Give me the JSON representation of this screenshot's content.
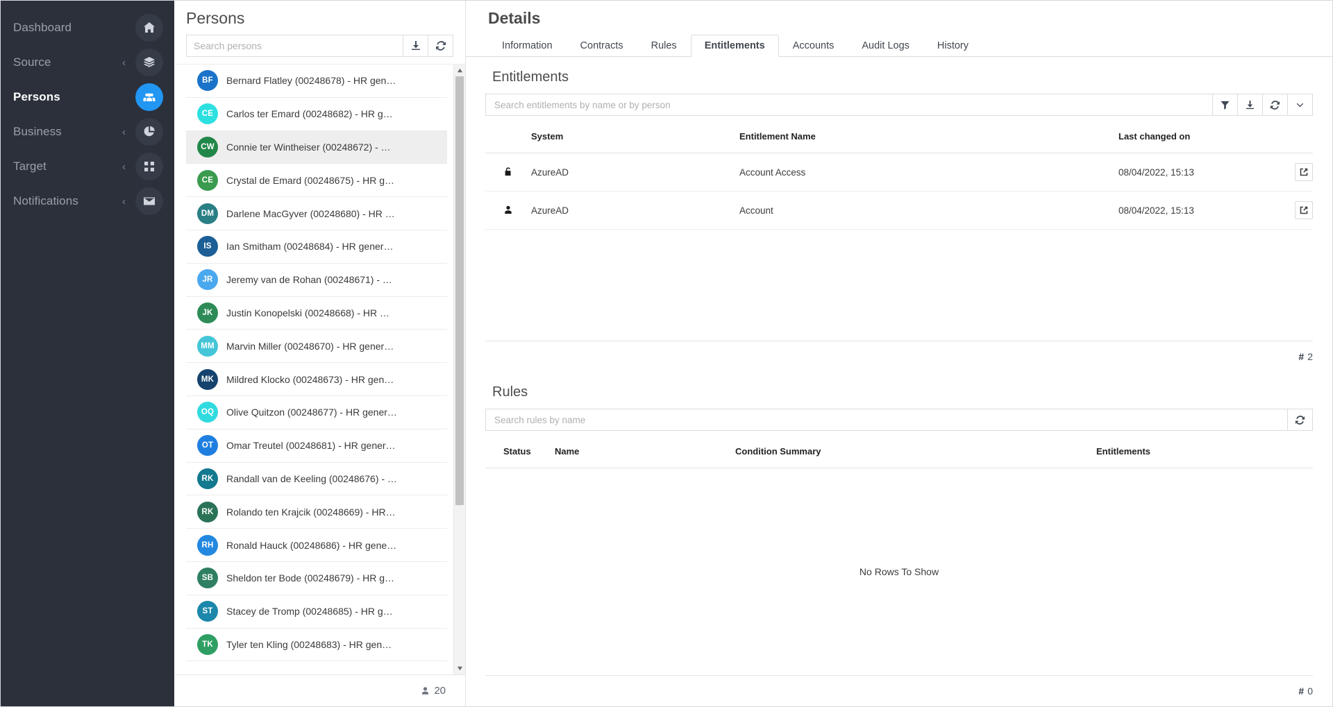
{
  "sidebar": {
    "items": [
      {
        "label": "Dashboard",
        "icon": "home-icon",
        "caret": false,
        "active": false
      },
      {
        "label": "Source",
        "icon": "layers-icon",
        "caret": true,
        "active": false
      },
      {
        "label": "Persons",
        "icon": "people-icon",
        "caret": false,
        "active": true
      },
      {
        "label": "Business",
        "icon": "pie-chart-icon",
        "caret": true,
        "active": false
      },
      {
        "label": "Target",
        "icon": "grid-icon",
        "caret": true,
        "active": false
      },
      {
        "label": "Notifications",
        "icon": "envelope-icon",
        "caret": true,
        "active": false
      }
    ],
    "caret_glyph": "‹",
    "accent_color": "#2196f3",
    "background_color": "#2b303b"
  },
  "persons": {
    "title": "Persons",
    "search_placeholder": "Search persons",
    "download_label": "download-icon",
    "refresh_label": "refresh-icon",
    "count": "20",
    "items": [
      {
        "initials": "BF",
        "color": "#1a73c8",
        "label": "Bernard Flatley (00248678) - HR gen…",
        "selected": false
      },
      {
        "initials": "CE",
        "color": "#2de0e0",
        "label": "Carlos ter Emard (00248682) - HR g…",
        "selected": false
      },
      {
        "initials": "CW",
        "color": "#218749",
        "label": "Connie ter Wintheiser (00248672) - …",
        "selected": true
      },
      {
        "initials": "CE",
        "color": "#3a9b4e",
        "label": "Crystal de Emard (00248675) - HR g…",
        "selected": false
      },
      {
        "initials": "DM",
        "color": "#2a7f85",
        "label": "Darlene MacGyver (00248680) - HR …",
        "selected": false
      },
      {
        "initials": "IS",
        "color": "#1b5f96",
        "label": "Ian Smitham (00248684) - HR gener…",
        "selected": false
      },
      {
        "initials": "JR",
        "color": "#4aa8ef",
        "label": "Jeremy van de Rohan (00248671) - …",
        "selected": false
      },
      {
        "initials": "JK",
        "color": "#2e8b57",
        "label": "Justin Konopelski (00248668) - HR …",
        "selected": false
      },
      {
        "initials": "MM",
        "color": "#44c6d8",
        "label": "Marvin Miller (00248670) - HR gener…",
        "selected": false
      },
      {
        "initials": "MK",
        "color": "#16436e",
        "label": "Mildred Klocko (00248673) - HR gen…",
        "selected": false
      },
      {
        "initials": "OQ",
        "color": "#30dbe0",
        "label": "Olive Quitzon (00248677) - HR gener…",
        "selected": false
      },
      {
        "initials": "OT",
        "color": "#1f7fe0",
        "label": "Omar Treutel (00248681) - HR gener…",
        "selected": false
      },
      {
        "initials": "RK",
        "color": "#12798f",
        "label": "Randall van de Keeling (00248676) - …",
        "selected": false
      },
      {
        "initials": "RK",
        "color": "#2b7357",
        "label": "Rolando ten Krajcik (00248669) - HR…",
        "selected": false
      },
      {
        "initials": "RH",
        "color": "#2288e0",
        "label": "Ronald Hauck (00248686) - HR gene…",
        "selected": false
      },
      {
        "initials": "SB",
        "color": "#2f7f62",
        "label": "Sheldon ter Bode (00248679) - HR g…",
        "selected": false
      },
      {
        "initials": "ST",
        "color": "#1b87aa",
        "label": "Stacey de Tromp (00248685) - HR g…",
        "selected": false
      },
      {
        "initials": "TK",
        "color": "#2f9e63",
        "label": "Tyler ten Kling (00248683) - HR gen…",
        "selected": false
      }
    ]
  },
  "details": {
    "title": "Details",
    "tabs": [
      {
        "label": "Information",
        "active": false
      },
      {
        "label": "Contracts",
        "active": false
      },
      {
        "label": "Rules",
        "active": false
      },
      {
        "label": "Entitlements",
        "active": true
      },
      {
        "label": "Accounts",
        "active": false
      },
      {
        "label": "Audit Logs",
        "active": false
      },
      {
        "label": "History",
        "active": false
      }
    ],
    "entitlements": {
      "title": "Entitlements",
      "search_placeholder": "Search entitlements by name or by person",
      "tools": [
        "filter-icon",
        "download-icon",
        "refresh-icon",
        "chevron-down-icon"
      ],
      "columns": [
        "",
        "System",
        "Entitlement Name",
        "Last changed on",
        ""
      ],
      "rows": [
        {
          "icon": "unlock-icon",
          "system": "AzureAD",
          "name": "Account Access",
          "changed": "08/04/2022, 15:13",
          "action": "open-external-icon"
        },
        {
          "icon": "user-icon",
          "system": "AzureAD",
          "name": "Account",
          "changed": "08/04/2022, 15:13",
          "action": "open-external-icon"
        }
      ],
      "count_prefix": "#",
      "count": "2"
    },
    "rules": {
      "title": "Rules",
      "search_placeholder": "Search rules by name",
      "tools": [
        "refresh-icon"
      ],
      "columns": [
        "Status",
        "Name",
        "Condition Summary",
        "Entitlements"
      ],
      "rows": [],
      "empty_message": "No Rows To Show",
      "count_prefix": "#",
      "count": "0"
    }
  }
}
